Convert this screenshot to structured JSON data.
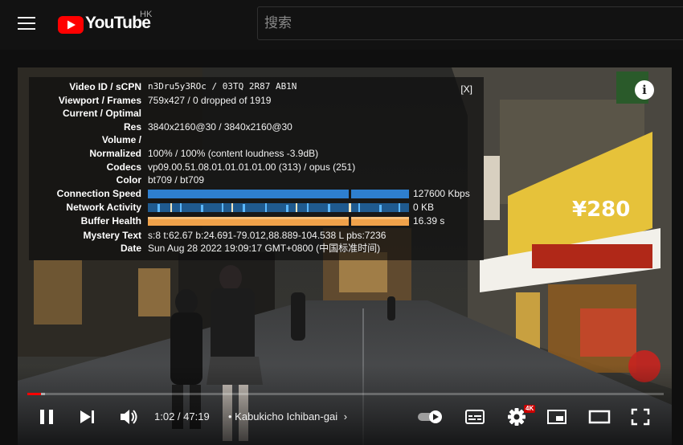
{
  "masthead": {
    "logo_text": "YouTube",
    "region": "HK",
    "search_placeholder": "搜索"
  },
  "stats_panel": {
    "close_label": "[X]",
    "rows": [
      {
        "label": "Video ID / sCPN",
        "value": "n3Dru5y3ROc / 03TQ 2R87 AB1N"
      },
      {
        "label": "Viewport / Frames",
        "value": "759x427 / 0 dropped of 1919"
      },
      {
        "label": "Current / Optimal",
        "value": ""
      },
      {
        "label": "Res",
        "value": "3840x2160@30 / 3840x2160@30"
      },
      {
        "label": "Volume /",
        "value": ""
      },
      {
        "label": "Normalized",
        "value": "100% / 100% (content loudness -3.9dB)"
      },
      {
        "label": "Codecs",
        "value": "vp09.00.51.08.01.01.01.01.00 (313) / opus (251)"
      },
      {
        "label": "Color",
        "value": "bt709 / bt709"
      },
      {
        "label": "Connection Speed",
        "value": "127600 Kbps"
      },
      {
        "label": "Network Activity",
        "value": "0 KB"
      },
      {
        "label": "Buffer Health",
        "value": "16.39 s"
      },
      {
        "label": "Mystery Text",
        "value": "s:8 t:62.67 b:24.691-79.012,88.889-104.538 L pbs:7236"
      },
      {
        "label": "Date",
        "value": "Sun Aug 28 2022 19:09:17 GMT+0800 (中国标准时间)"
      }
    ]
  },
  "player": {
    "time": "1:02 / 47:19",
    "chapter": "• Kabukicho Ichiban-gai",
    "chapter_chevron": "›",
    "quality_badge": "4K",
    "progress_played": 0.022,
    "progress_buffered": 0.028,
    "colors": {
      "accent": "#ff0000",
      "graph_blue": "#2e8de6",
      "graph_orange": "#f0a24a"
    }
  },
  "icons": [
    "menu-icon",
    "youtube-logo-icon",
    "info-icon",
    "pause-icon",
    "next-icon",
    "volume-icon",
    "autoplay-toggle-icon",
    "subtitles-icon",
    "gear-icon",
    "miniplayer-icon",
    "theater-icon",
    "fullscreen-icon"
  ]
}
